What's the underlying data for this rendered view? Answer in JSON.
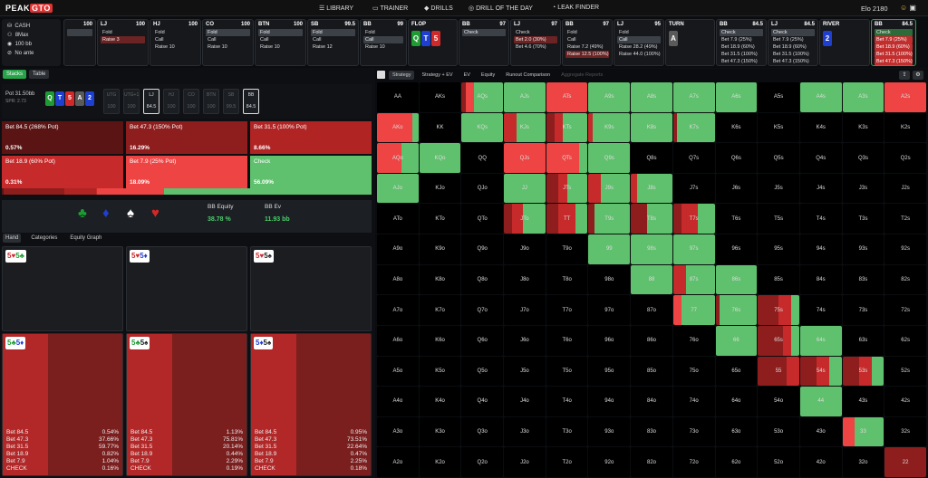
{
  "app": {
    "logo": "PEAKGTO",
    "nav": [
      "LIBRARY",
      "TRAINER",
      "DRILLS",
      "DRILL OF THE DAY",
      "LEAK FINDER"
    ],
    "elo": "Elo 2180"
  },
  "game": {
    "type": "CASH",
    "players": "8Max",
    "stack": "100 bb",
    "ante": "No ante"
  },
  "columns": [
    {
      "pos": "",
      "stack": "100",
      "opts": [
        {
          "t": "",
          "c": "sel"
        }
      ]
    },
    {
      "pos": "LJ",
      "stack": "100",
      "opts": [
        {
          "t": "Fold",
          "c": ""
        },
        {
          "t": "Raise 3",
          "c": "red"
        }
      ]
    },
    {
      "pos": "HJ",
      "stack": "100",
      "opts": [
        {
          "t": "Fold",
          "c": ""
        },
        {
          "t": "Call",
          "c": ""
        },
        {
          "t": "Raise 10",
          "c": ""
        }
      ]
    },
    {
      "pos": "CO",
      "stack": "100",
      "opts": [
        {
          "t": "Fold",
          "c": "sel"
        },
        {
          "t": "Call",
          "c": ""
        },
        {
          "t": "Raise 10",
          "c": ""
        }
      ]
    },
    {
      "pos": "BTN",
      "stack": "100",
      "opts": [
        {
          "t": "Fold",
          "c": "sel"
        },
        {
          "t": "Call",
          "c": ""
        },
        {
          "t": "Raise 10",
          "c": ""
        }
      ]
    },
    {
      "pos": "SB",
      "stack": "99.5",
      "opts": [
        {
          "t": "Fold",
          "c": "sel"
        },
        {
          "t": "Call",
          "c": ""
        },
        {
          "t": "Raise 12",
          "c": ""
        }
      ]
    },
    {
      "pos": "BB",
      "stack": "99",
      "opts": [
        {
          "t": "Fold",
          "c": ""
        },
        {
          "t": "Call",
          "c": "sel"
        },
        {
          "t": "Raise 10",
          "c": ""
        }
      ]
    },
    {
      "pos": "FLOP",
      "stack": "",
      "street": true,
      "cards": [
        {
          "r": "Q",
          "s": "club"
        },
        {
          "r": "T",
          "s": "dia"
        },
        {
          "r": "5",
          "s": "heart"
        }
      ]
    },
    {
      "pos": "BB",
      "stack": "97",
      "opts": [
        {
          "t": "Check",
          "c": "sel"
        }
      ]
    },
    {
      "pos": "LJ",
      "stack": "97",
      "opts": [
        {
          "t": "Check",
          "c": ""
        },
        {
          "t": "Bet 2.0 (30%)",
          "c": "red"
        },
        {
          "t": "Bet 4.6 (70%)",
          "c": ""
        }
      ]
    },
    {
      "pos": "BB",
      "stack": "97",
      "opts": [
        {
          "t": "Fold",
          "c": ""
        },
        {
          "t": "Call",
          "c": ""
        },
        {
          "t": "Raise 7.2 (49%)",
          "c": ""
        },
        {
          "t": "Raise 12.5 (100%)",
          "c": "red"
        }
      ]
    },
    {
      "pos": "LJ",
      "stack": "95",
      "opts": [
        {
          "t": "Fold",
          "c": ""
        },
        {
          "t": "Call",
          "c": "sel"
        },
        {
          "t": "Raise 28.2 (49%)",
          "c": ""
        },
        {
          "t": "Raise 44.0 (100%)",
          "c": ""
        }
      ]
    },
    {
      "pos": "TURN",
      "stack": "",
      "street": true,
      "cards": [
        {
          "r": "A",
          "s": "spade"
        }
      ]
    },
    {
      "pos": "BB",
      "stack": "84.5",
      "opts": [
        {
          "t": "Check",
          "c": "sel"
        },
        {
          "t": "Bet 7.9 (25%)",
          "c": ""
        },
        {
          "t": "Bet 18.9 (60%)",
          "c": ""
        },
        {
          "t": "Bet 31.5 (100%)",
          "c": ""
        },
        {
          "t": "Bet 47.3 (150%)",
          "c": ""
        }
      ]
    },
    {
      "pos": "LJ",
      "stack": "84.5",
      "opts": [
        {
          "t": "Check",
          "c": "sel"
        },
        {
          "t": "Bet 7.9 (25%)",
          "c": ""
        },
        {
          "t": "Bet 18.9 (60%)",
          "c": ""
        },
        {
          "t": "Bet 31.5 (100%)",
          "c": ""
        },
        {
          "t": "Bet 47.3 (150%)",
          "c": ""
        }
      ]
    },
    {
      "pos": "RIVER",
      "stack": "",
      "street": true,
      "cards": [
        {
          "r": "2",
          "s": "dia"
        }
      ]
    },
    {
      "pos": "BB",
      "stack": "84.5",
      "hl": true,
      "opts": [
        {
          "t": "Check",
          "c": "green"
        },
        {
          "t": "Bet 7.9 (25%)",
          "c": "r2"
        },
        {
          "t": "Bet 18.9 (60%)",
          "c": "r2"
        },
        {
          "t": "Bet 31.5 (100%)",
          "c": "r2"
        },
        {
          "t": "Bet 47.3 (150%)",
          "c": "r2"
        }
      ]
    }
  ],
  "left": {
    "tabs": [
      "Stacks",
      "Table"
    ],
    "pot": "Pot  31.50bb",
    "spr": "SPR: 2.73",
    "board": [
      {
        "r": "Q",
        "s": "club"
      },
      {
        "r": "T",
        "s": "dia"
      },
      {
        "r": "5",
        "s": "heart"
      },
      {
        "r": "A",
        "s": "spade"
      },
      {
        "r": "2",
        "s": "dia"
      }
    ],
    "seats": [
      {
        "n": "UTG",
        "v": "100"
      },
      {
        "n": "UTG+1",
        "v": "100"
      },
      {
        "n": "LJ",
        "v": "84.5",
        "a": true
      },
      {
        "n": "HJ",
        "v": "100"
      },
      {
        "n": "CO",
        "v": "100"
      },
      {
        "n": "BTN",
        "v": "100"
      },
      {
        "n": "SB",
        "v": "99.5"
      },
      {
        "n": "BB",
        "v": "84.5",
        "a": true
      }
    ],
    "actions": [
      {
        "label": "Bet 84.5 (268% Pot)",
        "pct": "0.57%",
        "bg": "#5a1414"
      },
      {
        "label": "Bet 47.3 (150% Pot)",
        "pct": "16.29%",
        "bg": "#8e1d1d"
      },
      {
        "label": "Bet 31.5 (100% Pot)",
        "pct": "8.66%",
        "bg": "#b02424"
      },
      {
        "label": "Bet 18.9 (60% Pot)",
        "pct": "0.31%",
        "bg": "#c72a2a"
      },
      {
        "label": "Bet 7.9 (25% Pot)",
        "pct": "18.09%",
        "bg": "#ee4444"
      },
      {
        "label": "Check",
        "pct": "56.09%",
        "bg": "#5fc06d"
      }
    ],
    "freq": [
      {
        "w": 0.57,
        "c": "#5a1414"
      },
      {
        "w": 16.29,
        "c": "#8e1d1d"
      },
      {
        "w": 8.66,
        "c": "#b02424"
      },
      {
        "w": 0.31,
        "c": "#c72a2a"
      },
      {
        "w": 18.09,
        "c": "#ee4444"
      },
      {
        "w": 56.09,
        "c": "#5fc06d"
      }
    ],
    "suits": [
      {
        "g": "♣",
        "c": "#1e9c33"
      },
      {
        "g": "♦",
        "c": "#1f3fd1"
      },
      {
        "g": "♠",
        "c": "#ffffff"
      },
      {
        "g": "♥",
        "c": "#d02929"
      }
    ],
    "equity_label": "BB Equity",
    "equity": "38.78 %",
    "ev_label": "BB Ev",
    "ev": "11.93 bb",
    "subtabs": [
      "Hand",
      "Categories",
      "Equity Graph"
    ],
    "top_combos": [
      {
        "a": "5",
        "as": "h",
        "b": "5",
        "bs": "c"
      },
      {
        "a": "5",
        "as": "h",
        "b": "5",
        "bs": "d"
      },
      {
        "a": "5",
        "as": "h",
        "b": "5",
        "bs": "s"
      }
    ],
    "combos": [
      {
        "a": "5",
        "as": "c",
        "b": "5",
        "bs": "d",
        "stats": [
          [
            "Bet 84.5",
            "0.54%"
          ],
          [
            "Bet 47.3",
            "37.66%"
          ],
          [
            "Bet 31.5",
            "59.77%"
          ],
          [
            "Bet 18.9",
            "0.82%"
          ],
          [
            "Bet 7.9",
            "1.04%"
          ],
          [
            "CHECK",
            "0.16%"
          ]
        ]
      },
      {
        "a": "5",
        "as": "c",
        "b": "5",
        "bs": "s",
        "stats": [
          [
            "Bet 84.5",
            "1.13%"
          ],
          [
            "Bet 47.3",
            "75.81%"
          ],
          [
            "Bet 31.5",
            "20.14%"
          ],
          [
            "Bet 18.9",
            "0.44%"
          ],
          [
            "Bet 7.9",
            "2.29%"
          ],
          [
            "CHECK",
            "0.19%"
          ]
        ]
      },
      {
        "a": "5",
        "as": "d",
        "b": "5",
        "bs": "s",
        "stats": [
          [
            "Bet 84.5",
            "0.95%"
          ],
          [
            "Bet 47.3",
            "73.51%"
          ],
          [
            "Bet 31.5",
            "22.64%"
          ],
          [
            "Bet 18.9",
            "0.47%"
          ],
          [
            "Bet 7.9",
            "2.25%"
          ],
          [
            "CHECK",
            "0.18%"
          ]
        ]
      }
    ]
  },
  "right": {
    "tabs": [
      "Strategy",
      "Strategy + EV",
      "EV",
      "Equity",
      "Runout Comparison",
      "Aggregate Reports"
    ]
  },
  "matrix": [
    [
      "AA",
      "AKs",
      "AQs",
      "AJs",
      "ATs",
      "A9s",
      "A8s",
      "A7s",
      "A6s",
      "A5s",
      "A4s",
      "A3s",
      "A2s"
    ],
    [
      "AKo",
      "KK",
      "KQs",
      "KJs",
      "KTs",
      "K9s",
      "K8s",
      "K7s",
      "K6s",
      "K5s",
      "K4s",
      "K3s",
      "K2s"
    ],
    [
      "AQo",
      "KQo",
      "QQ",
      "QJs",
      "QTs",
      "Q9s",
      "Q8s",
      "Q7s",
      "Q6s",
      "Q5s",
      "Q4s",
      "Q3s",
      "Q2s"
    ],
    [
      "AJo",
      "KJo",
      "QJo",
      "JJ",
      "JTs",
      "J9s",
      "J8s",
      "J7s",
      "J6s",
      "J5s",
      "J4s",
      "J3s",
      "J2s"
    ],
    [
      "ATo",
      "KTo",
      "QTo",
      "JTo",
      "TT",
      "T9s",
      "T8s",
      "T7s",
      "T6s",
      "T5s",
      "T4s",
      "T3s",
      "T2s"
    ],
    [
      "A9o",
      "K9o",
      "Q9o",
      "J9o",
      "T9o",
      "99",
      "98s",
      "97s",
      "96s",
      "95s",
      "94s",
      "93s",
      "92s"
    ],
    [
      "A8o",
      "K8o",
      "Q8o",
      "J8o",
      "T8o",
      "98o",
      "88",
      "87s",
      "86s",
      "85s",
      "84s",
      "83s",
      "82s"
    ],
    [
      "A7o",
      "K7o",
      "Q7o",
      "J7o",
      "T7o",
      "97o",
      "87o",
      "77",
      "76s",
      "75s",
      "74s",
      "73s",
      "72s"
    ],
    [
      "A6o",
      "K6o",
      "Q6o",
      "J6o",
      "T6o",
      "96o",
      "86o",
      "76o",
      "66",
      "65s",
      "64s",
      "63s",
      "62s"
    ],
    [
      "A5o",
      "K5o",
      "Q5o",
      "J5o",
      "T5o",
      "95o",
      "85o",
      "75o",
      "65o",
      "55",
      "54s",
      "53s",
      "52s"
    ],
    [
      "A4o",
      "K4o",
      "Q4o",
      "J4o",
      "T4o",
      "94o",
      "84o",
      "74o",
      "64o",
      "54o",
      "44",
      "43s",
      "42s"
    ],
    [
      "A3o",
      "K3o",
      "Q3o",
      "J3o",
      "T3o",
      "93o",
      "83o",
      "73o",
      "63o",
      "53o",
      "43o",
      "33",
      "32s"
    ],
    [
      "A2o",
      "K2o",
      "Q2o",
      "J2o",
      "T2o",
      "92o",
      "82o",
      "72o",
      "62o",
      "52o",
      "42o",
      "32o",
      "22"
    ]
  ],
  "matrix_mix": {
    "AQs": [
      [
        "r3",
        10
      ],
      [
        "r1",
        20
      ],
      [
        "g",
        70
      ]
    ],
    "AJs": [
      [
        "g",
        100
      ]
    ],
    "ATs": [
      [
        "r1",
        100
      ]
    ],
    "A9s": [
      [
        "g",
        100
      ]
    ],
    "A8s": [
      [
        "g",
        100
      ]
    ],
    "A7s": [
      [
        "g",
        100
      ]
    ],
    "A6s": [
      [
        "g",
        100
      ]
    ],
    "A4s": [
      [
        "g",
        100
      ]
    ],
    "A3s": [
      [
        "g",
        100
      ]
    ],
    "A2s": [
      [
        "r1",
        100
      ]
    ],
    "AKo": [
      [
        "r1",
        85
      ],
      [
        "g",
        15
      ]
    ],
    "KQs": [
      [
        "g",
        100
      ]
    ],
    "KJs": [
      [
        "r2",
        30
      ],
      [
        "g",
        70
      ]
    ],
    "KTs": [
      [
        "r3",
        20
      ],
      [
        "r2",
        20
      ],
      [
        "g",
        60
      ]
    ],
    "K9s": [
      [
        "r2",
        10
      ],
      [
        "g",
        90
      ]
    ],
    "K8s": [
      [
        "g",
        100
      ]
    ],
    "K7s": [
      [
        "r3",
        10
      ],
      [
        "g",
        90
      ]
    ],
    "AQo": [
      [
        "r1",
        60
      ],
      [
        "g",
        40
      ]
    ],
    "KQo": [
      [
        "g",
        100
      ]
    ],
    "QJs": [
      [
        "r1",
        100
      ]
    ],
    "QTs": [
      [
        "r1",
        80
      ],
      [
        "g",
        20
      ]
    ],
    "Q9s": [
      [
        "g",
        100
      ]
    ],
    "AJo": [
      [
        "g",
        100
      ]
    ],
    "JJ": [
      [
        "g",
        100
      ]
    ],
    "JTs": [
      [
        "r3",
        30
      ],
      [
        "r2",
        20
      ],
      [
        "g",
        50
      ]
    ],
    "J9s": [
      [
        "r2",
        30
      ],
      [
        "g",
        70
      ]
    ],
    "J8s": [
      [
        "r2",
        15
      ],
      [
        "g",
        85
      ]
    ],
    "JTo": [
      [
        "r3",
        20
      ],
      [
        "r2",
        25
      ],
      [
        "g",
        55
      ]
    ],
    "TT": [
      [
        "r3",
        30
      ],
      [
        "r2",
        40
      ],
      [
        "g",
        30
      ]
    ],
    "T9s": [
      [
        "r3",
        15
      ],
      [
        "g",
        85
      ]
    ],
    "T8s": [
      [
        "r3",
        40
      ],
      [
        "g",
        60
      ]
    ],
    "T7s": [
      [
        "r3",
        20
      ],
      [
        "r2",
        40
      ],
      [
        "g",
        40
      ]
    ],
    "99": [
      [
        "g",
        100
      ]
    ],
    "98s": [
      [
        "g",
        100
      ]
    ],
    "97s": [
      [
        "g",
        100
      ]
    ],
    "88": [
      [
        "g",
        100
      ]
    ],
    "87s": [
      [
        "r2",
        30
      ],
      [
        "g",
        70
      ]
    ],
    "86s": [
      [
        "g",
        100
      ]
    ],
    "77": [
      [
        "r1",
        20
      ],
      [
        "g",
        80
      ]
    ],
    "76s": [
      [
        "r3",
        10
      ],
      [
        "g",
        90
      ]
    ],
    "75s": [
      [
        "r3",
        50
      ],
      [
        "r2",
        30
      ],
      [
        "g",
        20
      ]
    ],
    "66": [
      [
        "g",
        100
      ]
    ],
    "65s": [
      [
        "r3",
        60
      ],
      [
        "r2",
        20
      ],
      [
        "g",
        20
      ]
    ],
    "64s": [
      [
        "g",
        100
      ]
    ],
    "55": [
      [
        "r3",
        70
      ],
      [
        "r2",
        30
      ]
    ],
    "54s": [
      [
        "r3",
        40
      ],
      [
        "r2",
        30
      ],
      [
        "g",
        30
      ]
    ],
    "53s": [
      [
        "r3",
        40
      ],
      [
        "r2",
        30
      ],
      [
        "g",
        30
      ]
    ],
    "44": [
      [
        "g",
        100
      ]
    ],
    "33": [
      [
        "r1",
        30
      ],
      [
        "g",
        70
      ]
    ],
    "22": [
      [
        "r3",
        100
      ]
    ]
  },
  "colors": {
    "g": "#5fc06d",
    "r1": "#ee4444",
    "r2": "#c72a2a",
    "r3": "#8e1d1d"
  }
}
